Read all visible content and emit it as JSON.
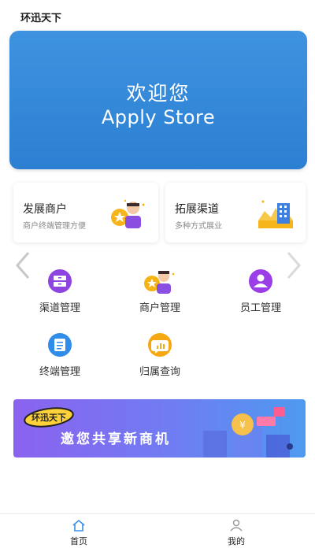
{
  "header": {
    "title": "环迅天下"
  },
  "hero": {
    "line1": "欢迎您",
    "line2": "Apply Store"
  },
  "cards": [
    {
      "title": "发展商户",
      "subtitle": "商户终端管理方便",
      "icon": "merchant-person-icon"
    },
    {
      "title": "拓展渠道",
      "subtitle": "多种方式展业",
      "icon": "city-buildings-icon"
    }
  ],
  "grid": [
    {
      "label": "渠道管理",
      "icon": "drawer-icon",
      "color": "#8e44e0"
    },
    {
      "label": "商户管理",
      "icon": "merchant-person-icon",
      "color": "#f5b414"
    },
    {
      "label": "员工管理",
      "icon": "employee-icon",
      "color": "#9b3ee8"
    },
    {
      "label": "终端管理",
      "icon": "document-icon",
      "color": "#2f8ce8"
    },
    {
      "label": "归属查询",
      "icon": "chart-bubble-icon",
      "color": "#f5a814"
    }
  ],
  "banner": {
    "tag": "环迅天下",
    "text": "邀您共享新商机"
  },
  "nav": [
    {
      "label": "首页",
      "icon": "home-icon",
      "active": true
    },
    {
      "label": "我的",
      "icon": "user-icon",
      "active": false
    }
  ],
  "colors": {
    "hero": "#3286d8",
    "banner_start": "#8b62f0",
    "banner_end": "#4e9af0"
  }
}
